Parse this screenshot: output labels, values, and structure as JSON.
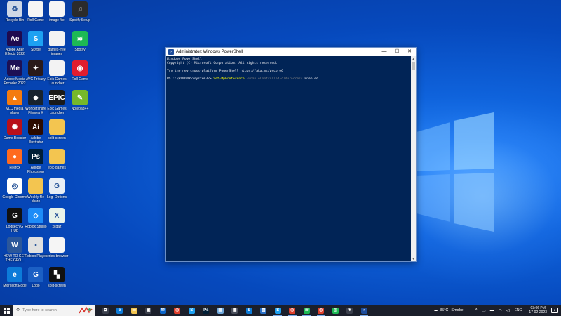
{
  "desktop": {
    "icons": [
      {
        "label": "Recycle Bin",
        "icon": "recycle-bin-icon",
        "color": "#cfd8e6",
        "glyph": "♻"
      },
      {
        "label": "Roll Game",
        "icon": "document-icon",
        "color": "#f5f5f5",
        "glyph": ""
      },
      {
        "label": "image file",
        "icon": "image-file-icon",
        "color": "#f5f5f5",
        "glyph": ""
      },
      {
        "label": "Spotify Setup",
        "icon": "spotify-setup-icon",
        "color": "#2b2b2b",
        "glyph": "♫"
      },
      {
        "label": "Adobe After Effects 2022",
        "icon": "after-effects-icon",
        "color": "#1f0a4e",
        "glyph": "Ae"
      },
      {
        "label": "Skype",
        "icon": "skype-icon",
        "color": "#1da1f2",
        "glyph": "S"
      },
      {
        "label": "games-free images",
        "icon": "folder-icon",
        "color": "#f3f3f3",
        "glyph": ""
      },
      {
        "label": "Spotify",
        "icon": "spotify-icon",
        "color": "#1db954",
        "glyph": "≋"
      },
      {
        "label": "Adobe Media Encoder 2022",
        "icon": "media-encoder-icon",
        "color": "#1d1054",
        "glyph": "Me"
      },
      {
        "label": "AVG Privacy",
        "icon": "avg-icon",
        "color": "#2a1a1a",
        "glyph": "✦"
      },
      {
        "label": "Epic Games Launcher",
        "icon": "launcher-icon",
        "color": "#f3f3f3",
        "glyph": ""
      },
      {
        "label": "Roll Game",
        "icon": "roll-game-icon",
        "color": "#e11d2e",
        "glyph": "◉"
      },
      {
        "label": "VLC media player",
        "icon": "vlc-icon",
        "color": "#f47b0f",
        "glyph": "▲"
      },
      {
        "label": "Wondershare Filmora X",
        "icon": "filmora-icon",
        "color": "#18232e",
        "glyph": "◆"
      },
      {
        "label": "Epic Games Launcher",
        "icon": "epic-games-icon",
        "color": "#1a1a1a",
        "glyph": "EPIC"
      },
      {
        "label": "Notepad++",
        "icon": "notepad-plus-plus-icon",
        "color": "#76b82a",
        "glyph": "✎"
      },
      {
        "label": "Game Booster",
        "icon": "game-booster-icon",
        "color": "#b8101a",
        "glyph": "✺"
      },
      {
        "label": "Adobe Illustrator",
        "icon": "illustrator-icon",
        "color": "#2c0b00",
        "glyph": "Ai"
      },
      {
        "label": "split-screen",
        "icon": "folder-icon",
        "color": "#f3c550",
        "glyph": ""
      },
      {
        "label": "Firefox",
        "icon": "firefox-icon",
        "color": "#ff6a1f",
        "glyph": "●"
      },
      {
        "label": "Adobe Photoshop",
        "icon": "photoshop-icon",
        "color": "#001e36",
        "glyph": "Ps"
      },
      {
        "label": "epic-games",
        "icon": "folder-icon",
        "color": "#f3c550",
        "glyph": ""
      },
      {
        "label": "Google Chrome",
        "icon": "chrome-icon",
        "color": "#ffffff",
        "glyph": "◎"
      },
      {
        "label": "Weekly file share",
        "icon": "folder-icon",
        "color": "#f3c550",
        "glyph": ""
      },
      {
        "label": "Logi Options",
        "icon": "logi-options-icon",
        "color": "#e8eef5",
        "glyph": "G"
      },
      {
        "label": "Logitech G HUB",
        "icon": "g-hub-icon",
        "color": "#111111",
        "glyph": "G"
      },
      {
        "label": "Roblox Studio",
        "icon": "roblox-studio-icon",
        "color": "#1d8cf8",
        "glyph": "◇"
      },
      {
        "label": "xcdaz",
        "icon": "excel-file-icon",
        "color": "#e8f3ea",
        "glyph": "X"
      },
      {
        "label": "HOW TO GET THE GEO...",
        "icon": "word-doc-icon",
        "color": "#2b579a",
        "glyph": "W"
      },
      {
        "label": "Roblox Player",
        "icon": "roblox-player-icon",
        "color": "#e0e0e0",
        "glyph": "▪"
      },
      {
        "label": "series-browser",
        "icon": "document-icon",
        "color": "#f5f5f5",
        "glyph": ""
      },
      {
        "label": "Microsoft Edge",
        "icon": "edge-icon",
        "color": "#0c7bd9",
        "glyph": "e"
      },
      {
        "label": "Logo",
        "icon": "logo-icon",
        "color": "#1b5fc4",
        "glyph": "G"
      },
      {
        "label": "split-screen",
        "icon": "split-screen-icon",
        "color": "#111111",
        "glyph": "▚"
      }
    ]
  },
  "window": {
    "title": "Administrator: Windows PowerShell",
    "controls": {
      "minimize": "—",
      "maximize": "☐",
      "close": "✕"
    },
    "console": {
      "line1": "Windows PowerShell",
      "line2": "Copyright (C) Microsoft Corporation. All rights reserved.",
      "line3": "Try the new cross-platform PowerShell https://aka.ms/pscore6",
      "prompt": "PS C:\\WINDOWS\\system32> ",
      "command": "Set-MpPreference",
      "parameter": " -EnableControlledFolderAccess",
      "argument": " Enabled"
    }
  },
  "taskbar": {
    "search_placeholder": "Type here to search",
    "apps": [
      {
        "icon": "task-view-icon",
        "color": "#3a3f4c",
        "glyph": "⧉",
        "active": false
      },
      {
        "icon": "edge-icon",
        "color": "#0c7bd9",
        "glyph": "e",
        "active": false
      },
      {
        "icon": "file-explorer-icon",
        "color": "#f3c550",
        "glyph": "▭",
        "active": false
      },
      {
        "icon": "store-icon",
        "color": "#3a3f4c",
        "glyph": "▣",
        "active": false
      },
      {
        "icon": "mail-icon",
        "color": "#0a64c8",
        "glyph": "✉",
        "active": false
      },
      {
        "icon": "chrome-icon",
        "color": "#de3f2c",
        "glyph": "◎",
        "active": false
      },
      {
        "icon": "skype-icon",
        "color": "#1da1f2",
        "glyph": "S",
        "active": false
      },
      {
        "icon": "photoshop-icon",
        "color": "#001e36",
        "glyph": "Ps",
        "active": false
      },
      {
        "icon": "notepad-icon",
        "color": "#6fa8dc",
        "glyph": "▤",
        "active": false
      },
      {
        "icon": "calculator-icon",
        "color": "#4a4f5c",
        "glyph": "▦",
        "active": false
      },
      {
        "icon": "bing-icon",
        "color": "#0c7bd9",
        "glyph": "b",
        "active": false
      },
      {
        "icon": "photos-icon",
        "color": "#2a70c8",
        "glyph": "▨",
        "active": false
      },
      {
        "icon": "skype-icon",
        "color": "#1da1f2",
        "glyph": "S",
        "active": true
      },
      {
        "icon": "chrome-icon",
        "color": "#de3f2c",
        "glyph": "◎",
        "active": true
      },
      {
        "icon": "spotify-icon",
        "color": "#1db954",
        "glyph": "≋",
        "active": true
      },
      {
        "icon": "chrome-icon",
        "color": "#de3f2c",
        "glyph": "◎",
        "active": true
      },
      {
        "icon": "chrome-icon",
        "color": "#1db954",
        "glyph": "◎",
        "active": false
      },
      {
        "icon": "shield-icon",
        "color": "#3a3f4c",
        "glyph": "⛨",
        "active": false
      },
      {
        "icon": "powershell-icon",
        "color": "#1e4d9c",
        "glyph": "›",
        "active": true
      }
    ],
    "weather": {
      "temp": "35°C",
      "condition": "Smoke"
    },
    "language": "ENG",
    "time": "03:06 PM",
    "date": "17-02-2023",
    "notifications": "2"
  }
}
